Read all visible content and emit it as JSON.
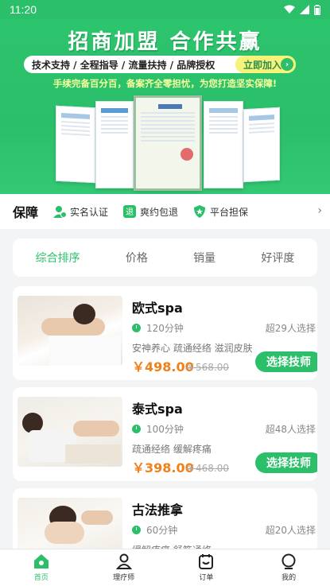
{
  "status_bar": {
    "time": "11:20"
  },
  "banner": {
    "title": "招商加盟 合作共赢",
    "pill_text": "技术支持 / 全程指导 / 流量扶持 / 品牌授权",
    "join_label": "立即加入",
    "subtitle": "手续完备百分百，备案齐全零担忧，为您打造坚实保障!"
  },
  "guarantee": {
    "title": "保障",
    "items": [
      {
        "label": "实名认证"
      },
      {
        "label": "爽约包退"
      },
      {
        "label": "平台担保"
      }
    ]
  },
  "sort_tabs": [
    {
      "label": "综合排序"
    },
    {
      "label": "价格"
    },
    {
      "label": "销量"
    },
    {
      "label": "好评度"
    }
  ],
  "services": [
    {
      "name": "欧式spa",
      "duration": "120分钟",
      "selected": "超29人选择",
      "tags": "安神养心 疏通经络 滋润皮肤",
      "price": "￥498.00",
      "old_price": "￥568.00",
      "button": "选择技师"
    },
    {
      "name": "泰式spa",
      "duration": "100分钟",
      "selected": "超48人选择",
      "tags": "疏通经络 缓解疼痛",
      "price": "￥398.00",
      "old_price": "￥468.00",
      "button": "选择技师"
    },
    {
      "name": "古法推拿",
      "duration": "60分钟",
      "selected": "超20人选择",
      "tags": "缓解疼痛 舒筋通络",
      "price": "",
      "old_price": "",
      "button": ""
    }
  ],
  "tabbar": [
    {
      "label": "首页"
    },
    {
      "label": "理疗师"
    },
    {
      "label": "订单"
    },
    {
      "label": "我的"
    }
  ],
  "colors": {
    "brand": "#2bbf6a",
    "price": "#f0801a",
    "highlight": "#f6f27a"
  }
}
